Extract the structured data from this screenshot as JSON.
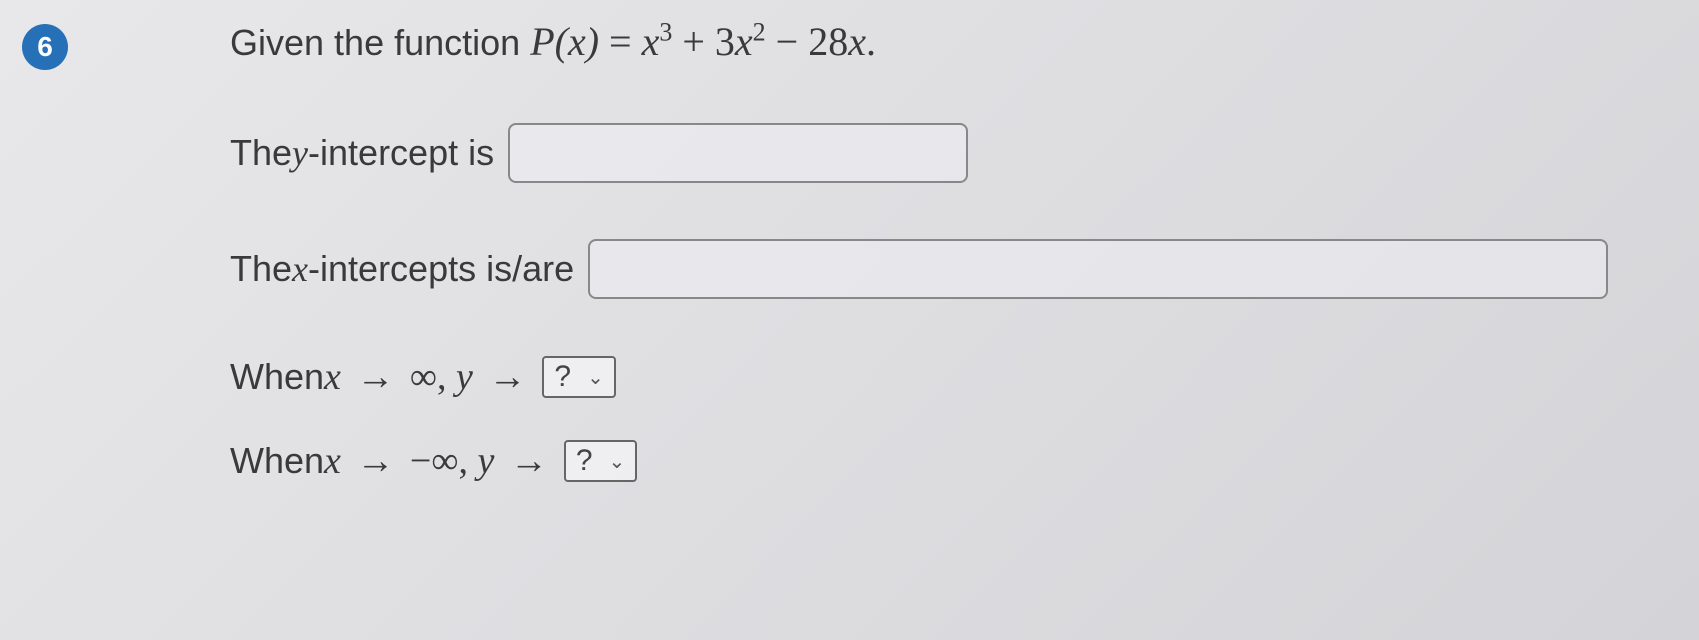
{
  "question": {
    "number": "6",
    "prompt_prefix": "Given the function ",
    "function_lhs": "P(x)",
    "function_equals": " = ",
    "function_rhs_parts": {
      "t1_var": "x",
      "t1_exp": "3",
      "plus": " + ",
      "t2_coef": "3",
      "t2_var": "x",
      "t2_exp": "2",
      "minus": " − ",
      "t3_coef": "28",
      "t3_var": "x",
      "period": "."
    }
  },
  "yintercept": {
    "prefix": "The ",
    "var": "y",
    "suffix": "-intercept is"
  },
  "xintercept": {
    "prefix": "The ",
    "var": "x",
    "suffix": "-intercepts is/are"
  },
  "limit1": {
    "prefix": "When ",
    "x": "x",
    "arrow1": "→",
    "inf": "∞",
    "comma": ", ",
    "y": "y",
    "arrow2": "→",
    "select": "?"
  },
  "limit2": {
    "prefix": "When ",
    "x": "x",
    "arrow1": "→",
    "neginf": "−∞",
    "comma": ", ",
    "y": "y",
    "arrow2": "→",
    "select": "?"
  }
}
